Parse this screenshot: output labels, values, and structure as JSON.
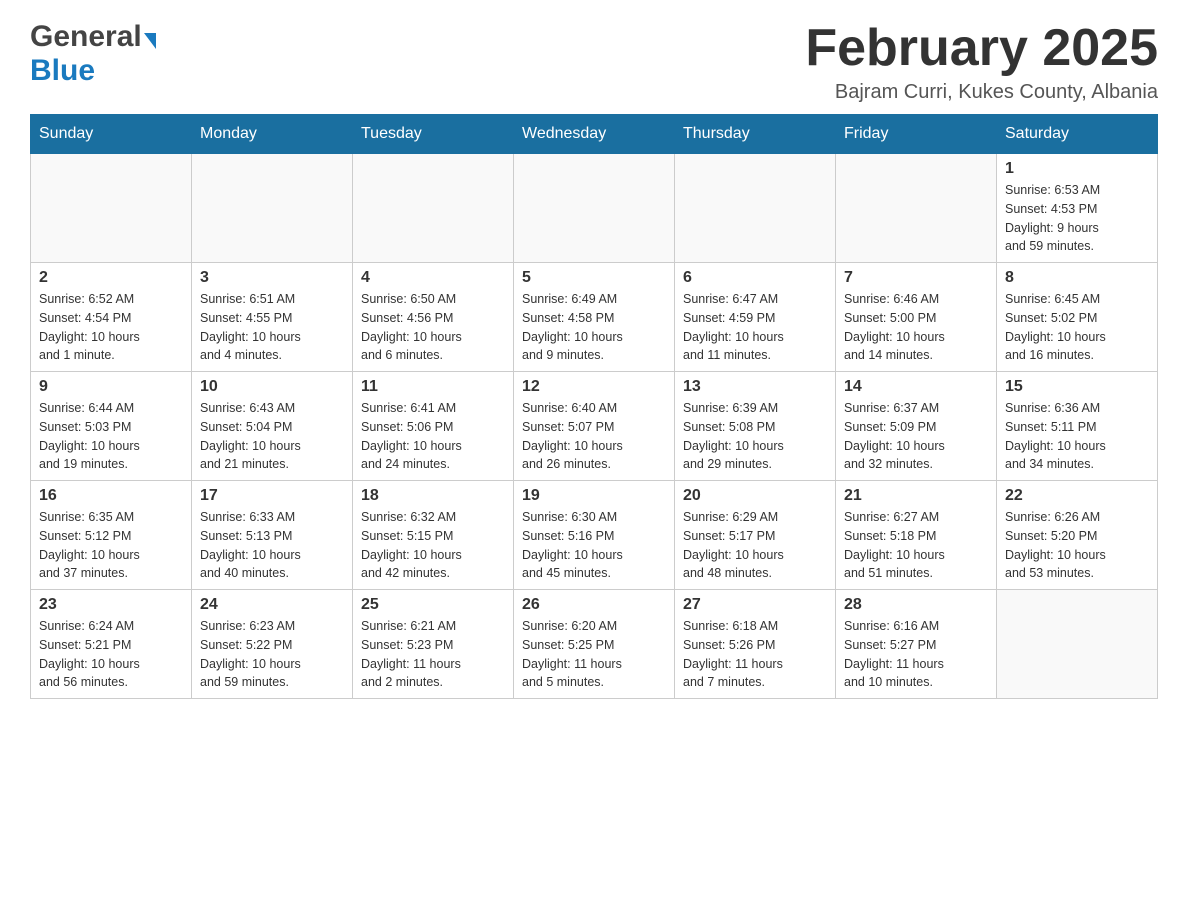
{
  "header": {
    "logo_general": "General",
    "logo_blue": "Blue",
    "month_title": "February 2025",
    "location": "Bajram Curri, Kukes County, Albania"
  },
  "days_of_week": [
    "Sunday",
    "Monday",
    "Tuesday",
    "Wednesday",
    "Thursday",
    "Friday",
    "Saturday"
  ],
  "weeks": [
    [
      {
        "day": "",
        "info": ""
      },
      {
        "day": "",
        "info": ""
      },
      {
        "day": "",
        "info": ""
      },
      {
        "day": "",
        "info": ""
      },
      {
        "day": "",
        "info": ""
      },
      {
        "day": "",
        "info": ""
      },
      {
        "day": "1",
        "info": "Sunrise: 6:53 AM\nSunset: 4:53 PM\nDaylight: 9 hours\nand 59 minutes."
      }
    ],
    [
      {
        "day": "2",
        "info": "Sunrise: 6:52 AM\nSunset: 4:54 PM\nDaylight: 10 hours\nand 1 minute."
      },
      {
        "day": "3",
        "info": "Sunrise: 6:51 AM\nSunset: 4:55 PM\nDaylight: 10 hours\nand 4 minutes."
      },
      {
        "day": "4",
        "info": "Sunrise: 6:50 AM\nSunset: 4:56 PM\nDaylight: 10 hours\nand 6 minutes."
      },
      {
        "day": "5",
        "info": "Sunrise: 6:49 AM\nSunset: 4:58 PM\nDaylight: 10 hours\nand 9 minutes."
      },
      {
        "day": "6",
        "info": "Sunrise: 6:47 AM\nSunset: 4:59 PM\nDaylight: 10 hours\nand 11 minutes."
      },
      {
        "day": "7",
        "info": "Sunrise: 6:46 AM\nSunset: 5:00 PM\nDaylight: 10 hours\nand 14 minutes."
      },
      {
        "day": "8",
        "info": "Sunrise: 6:45 AM\nSunset: 5:02 PM\nDaylight: 10 hours\nand 16 minutes."
      }
    ],
    [
      {
        "day": "9",
        "info": "Sunrise: 6:44 AM\nSunset: 5:03 PM\nDaylight: 10 hours\nand 19 minutes."
      },
      {
        "day": "10",
        "info": "Sunrise: 6:43 AM\nSunset: 5:04 PM\nDaylight: 10 hours\nand 21 minutes."
      },
      {
        "day": "11",
        "info": "Sunrise: 6:41 AM\nSunset: 5:06 PM\nDaylight: 10 hours\nand 24 minutes."
      },
      {
        "day": "12",
        "info": "Sunrise: 6:40 AM\nSunset: 5:07 PM\nDaylight: 10 hours\nand 26 minutes."
      },
      {
        "day": "13",
        "info": "Sunrise: 6:39 AM\nSunset: 5:08 PM\nDaylight: 10 hours\nand 29 minutes."
      },
      {
        "day": "14",
        "info": "Sunrise: 6:37 AM\nSunset: 5:09 PM\nDaylight: 10 hours\nand 32 minutes."
      },
      {
        "day": "15",
        "info": "Sunrise: 6:36 AM\nSunset: 5:11 PM\nDaylight: 10 hours\nand 34 minutes."
      }
    ],
    [
      {
        "day": "16",
        "info": "Sunrise: 6:35 AM\nSunset: 5:12 PM\nDaylight: 10 hours\nand 37 minutes."
      },
      {
        "day": "17",
        "info": "Sunrise: 6:33 AM\nSunset: 5:13 PM\nDaylight: 10 hours\nand 40 minutes."
      },
      {
        "day": "18",
        "info": "Sunrise: 6:32 AM\nSunset: 5:15 PM\nDaylight: 10 hours\nand 42 minutes."
      },
      {
        "day": "19",
        "info": "Sunrise: 6:30 AM\nSunset: 5:16 PM\nDaylight: 10 hours\nand 45 minutes."
      },
      {
        "day": "20",
        "info": "Sunrise: 6:29 AM\nSunset: 5:17 PM\nDaylight: 10 hours\nand 48 minutes."
      },
      {
        "day": "21",
        "info": "Sunrise: 6:27 AM\nSunset: 5:18 PM\nDaylight: 10 hours\nand 51 minutes."
      },
      {
        "day": "22",
        "info": "Sunrise: 6:26 AM\nSunset: 5:20 PM\nDaylight: 10 hours\nand 53 minutes."
      }
    ],
    [
      {
        "day": "23",
        "info": "Sunrise: 6:24 AM\nSunset: 5:21 PM\nDaylight: 10 hours\nand 56 minutes."
      },
      {
        "day": "24",
        "info": "Sunrise: 6:23 AM\nSunset: 5:22 PM\nDaylight: 10 hours\nand 59 minutes."
      },
      {
        "day": "25",
        "info": "Sunrise: 6:21 AM\nSunset: 5:23 PM\nDaylight: 11 hours\nand 2 minutes."
      },
      {
        "day": "26",
        "info": "Sunrise: 6:20 AM\nSunset: 5:25 PM\nDaylight: 11 hours\nand 5 minutes."
      },
      {
        "day": "27",
        "info": "Sunrise: 6:18 AM\nSunset: 5:26 PM\nDaylight: 11 hours\nand 7 minutes."
      },
      {
        "day": "28",
        "info": "Sunrise: 6:16 AM\nSunset: 5:27 PM\nDaylight: 11 hours\nand 10 minutes."
      },
      {
        "day": "",
        "info": ""
      }
    ]
  ]
}
